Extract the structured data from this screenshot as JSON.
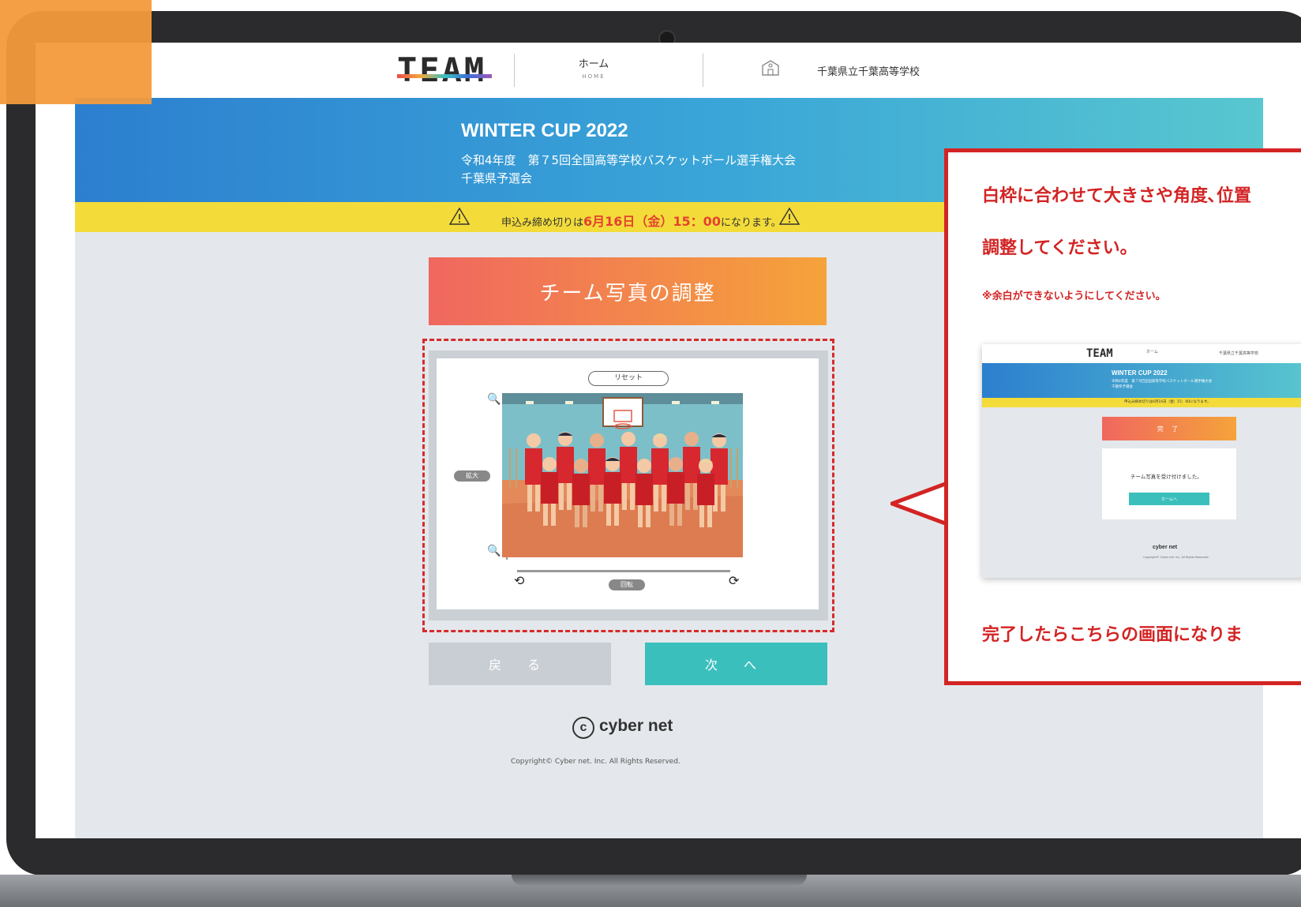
{
  "header": {
    "logo": "TEAM",
    "nav_home_label": "ホーム",
    "nav_home_sub": "HOME",
    "school_name": "千葉県立千葉高等学校"
  },
  "banner": {
    "title": "WINTER CUP 2022",
    "subtitle_line1": "令和4年度　第７5回全国高等学校バスケットボール選手権大会",
    "subtitle_line2": "千葉県予選会"
  },
  "notice": {
    "prefix": "申込み締め切りは",
    "deadline": "6月16日（金）15：00",
    "suffix": "になります。"
  },
  "main": {
    "title": "チーム写真の調整",
    "editor": {
      "reset_label": "リセット",
      "zoom_label": "拡大",
      "rotate_label": "回転"
    },
    "back_label": "戻 る",
    "next_label": "次 へ"
  },
  "footer": {
    "logo": "cyber net",
    "copyright": "Copyright© Cyber net. Inc. All Rights Reserved."
  },
  "callout": {
    "line1": "白枠に合わせて大きさや角度､位置",
    "line2": "調整してください。",
    "note": "※余白ができないようにしてください。",
    "done_text": "完了したらこちらの画面になりま",
    "preview": {
      "logo": "TEAM",
      "home": "ホーム",
      "school": "千葉県立千葉高等学校",
      "title": "WINTER CUP 2022",
      "sub1": "令和4年度　第７5回全国高等学校バスケットボール選手権大会",
      "sub2": "千葉県予選会",
      "notice": "申込み締め切りは6月16日（金）15：00になります。",
      "done_button": "完 了",
      "card_text": "チーム写真を受け付けました。",
      "home_button": "ホームへ",
      "footer_logo": "cyber net",
      "copyright": "Copyright© Cyber net. Inc. All Rights Reserved."
    }
  },
  "colors": {
    "accent_red": "#d32424",
    "teal": "#3bbfbd",
    "notice_yellow": "#f3dc3a",
    "orange_tab": "#f39a3b"
  }
}
